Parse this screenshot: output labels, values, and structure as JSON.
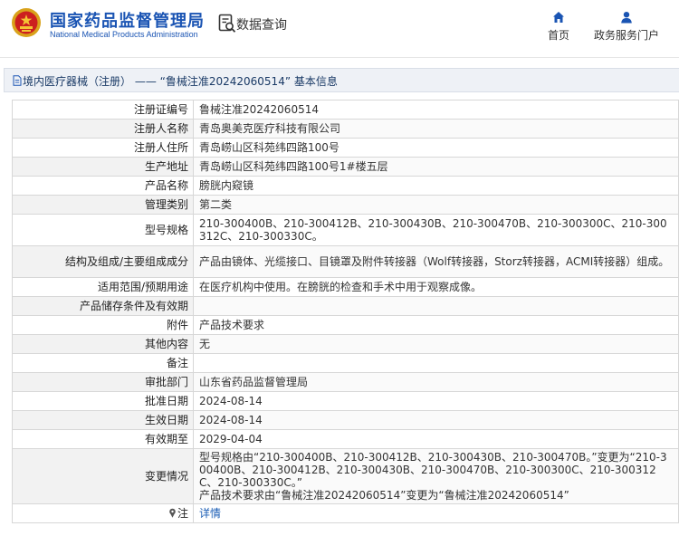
{
  "header": {
    "org_cn": "国家药品监督管理局",
    "org_en": "National Medical Products Administration",
    "query_label": "数据查询",
    "nav": [
      {
        "label": "首页",
        "icon": "home-icon"
      },
      {
        "label": "政务服务门户",
        "icon": "user-icon"
      }
    ]
  },
  "title_bar": {
    "text": "境内医疗器械（注册） —— “鲁械注准20242060514” 基本信息"
  },
  "detail": {
    "rows": [
      {
        "label": "注册证编号",
        "value": "鲁械注准20242060514"
      },
      {
        "label": "注册人名称",
        "value": "青岛奥美克医疗科技有限公司"
      },
      {
        "label": "注册人住所",
        "value": "青岛崂山区科苑纬四路100号"
      },
      {
        "label": "生产地址",
        "value": "青岛崂山区科苑纬四路100号1#楼五层"
      },
      {
        "label": "产品名称",
        "value": "膀胱内窥镜"
      },
      {
        "label": "管理类别",
        "value": "第二类"
      },
      {
        "label": "型号规格",
        "value": "210-300400B、210-300412B、210-300430B、210-300470B、210-300300C、210-300312C、210-300330C。"
      },
      {
        "label": "结构及组成/主要组成成分",
        "value": "产品由镜体、光缆接口、目镜罩及附件转接器（Wolf转接器，Storz转接器，ACMI转接器）组成。"
      },
      {
        "label": "适用范围/预期用途",
        "value": "在医疗机构中使用。在膀胱的检查和手术中用于观察成像。"
      },
      {
        "label": "产品储存条件及有效期",
        "value": ""
      },
      {
        "label": "附件",
        "value": "产品技术要求"
      },
      {
        "label": "其他内容",
        "value": "无"
      },
      {
        "label": "备注",
        "value": ""
      },
      {
        "label": "审批部门",
        "value": "山东省药品监督管理局"
      },
      {
        "label": "批准日期",
        "value": "2024-08-14"
      },
      {
        "label": "生效日期",
        "value": "2024-08-14"
      },
      {
        "label": "有效期至",
        "value": "2029-04-04"
      }
    ],
    "change": {
      "label": "变更情况",
      "line1": "型号规格由“210-300400B、210-300412B、210-300430B、210-300470B。”变更为“210-300400B、210-300412B、210-300430B、210-300470B、210-300300C、210-300312C、210-300330C。”",
      "line2": "产品技术要求由“鲁械注准20242060514”变更为“鲁械注准20242060514”"
    },
    "note": {
      "label": "注",
      "link": "详情",
      "icon": "pin-icon"
    }
  },
  "colors": {
    "brand_blue": "#1a54b3",
    "title_bar_bg": "#eef1f6",
    "link": "#1a5db5"
  }
}
